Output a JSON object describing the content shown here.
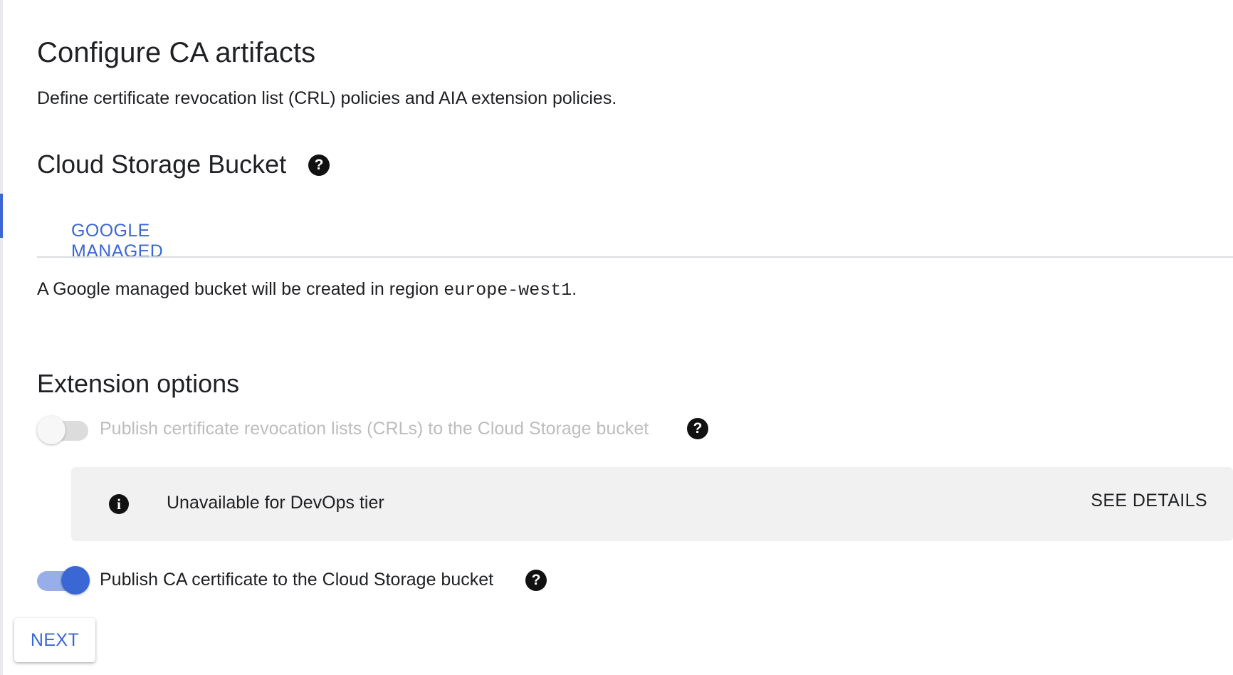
{
  "page": {
    "title": "Configure CA artifacts",
    "subtitle": "Define certificate revocation list (CRL) policies and AIA extension policies."
  },
  "bucket": {
    "heading": "Cloud Storage Bucket",
    "help_icon": "help-icon",
    "tab_label": "GOOGLE MANAGED",
    "note_prefix": "A Google managed bucket will be created in region ",
    "region": "europe-west1",
    "note_suffix": "."
  },
  "extensions": {
    "heading": "Extension options",
    "crl_option": {
      "label": "Publish certificate revocation lists (CRLs) to the Cloud Storage bucket",
      "enabled": false,
      "disabled": true,
      "help_icon": "help-icon"
    },
    "info": {
      "icon": "info-icon",
      "icon_glyph": "i",
      "text": "Unavailable for DevOps tier",
      "action": "SEE DETAILS"
    },
    "ca_option": {
      "label": "Publish CA certificate to the Cloud Storage bucket",
      "enabled": true,
      "help_icon": "help-icon"
    }
  },
  "help_glyph": "?",
  "footer": {
    "next_label": "NEXT"
  },
  "colors": {
    "accent": "#3b67d5",
    "toggle_on_track": "#98aee9",
    "disabled_text": "#bdbdbd",
    "info_background": "#f1f1f1"
  }
}
